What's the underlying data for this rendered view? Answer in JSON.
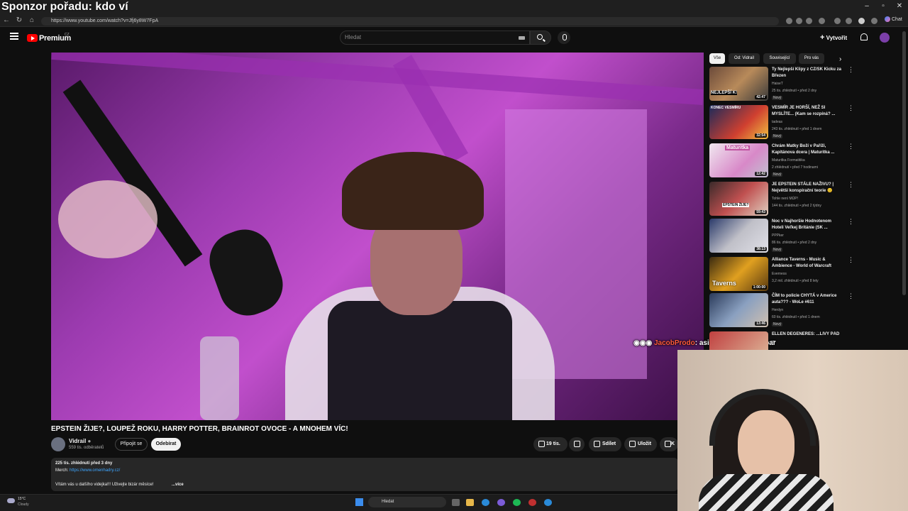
{
  "overlay_title": "Sponzor pořadu: kdo ví",
  "browser": {
    "url": "https://www.youtube.com/watch?v=Jfj6y8W7FpA",
    "copilot_label": "Chat",
    "window_buttons": [
      "–",
      "▫",
      "✕"
    ]
  },
  "header": {
    "logo_text": "Premium",
    "region": "CZ",
    "search_placeholder": "Hledat",
    "create_label": "Vytvořit"
  },
  "video": {
    "title": "EPSTEIN ŽIJE?, LOUPEŽ ROKU, HARRY POTTER, BRAINROT OVOCE - A MNOHEM VÍC!",
    "channel": "Vidrail",
    "subscribers": "559 tis. odběratelů",
    "join_label": "Připojit se",
    "subscribe_label": "Odebírat",
    "likes": "19 tis.",
    "share_label": "Sdílet",
    "save_label": "Uložit",
    "clip_label": "K"
  },
  "description": {
    "views_date": "225 tis. zhlédnutí  před 3 dny",
    "merch_label": "Merch:",
    "merch_link": "https://www.omenhadry.cz/",
    "text": "Vítám vás u dalšího videjka!!! Uživejte bizár měsíce!",
    "more_label": "...více"
  },
  "chat_overlay": {
    "user": "JacobProdo",
    "message": ": asi furt lepší než separ"
  },
  "sidebar": {
    "chips": [
      "Vše",
      "Od: Vidrail",
      "Související",
      "Pro vás"
    ],
    "items": [
      {
        "title": "Ty Nejlepší Klipy z CZ/SK Kicku za Březen",
        "channel": "HaiseT",
        "meta": "25 tis. zhlédnutí • před 2 dny",
        "badge": "Nový",
        "duration": "42:47",
        "thumb_text": "NEJLEPŠÍ K!"
      },
      {
        "title": "VESMÍR JE HORŠÍ, NEŽ SI MYSLÍTE... (Kam se rozpíná? ...",
        "channel": "tadeas",
        "meta": "243 tis. zhlédnutí • před 1 dnem",
        "badge": "Nový",
        "duration": "32:54",
        "thumb_text": "KONEC VESMÍRU"
      },
      {
        "title": "Chrám Matky Boží v Paříži, Kapitánova dcera | Maturitka ...",
        "channel": "Maturitka Formatitika",
        "meta": "2 zhlédnutí • před 7 hodinami",
        "badge": "Nový",
        "duration": "12:42",
        "thumb_text": "Maturitka"
      },
      {
        "title": "JE EPSTEIN STÁLE NAŽIVU? | Největší konspirační teorie 😐",
        "channel": "Tohle není MÚP!",
        "meta": "144 tis. zhlédnutí • před 2 týdny",
        "badge": "",
        "duration": "59:43",
        "thumb_text": "EPSTEIN ŽIJE?"
      },
      {
        "title": "Noc v Najhoršie Hodnotenom Hoteli Veľkej Británie (SK ...",
        "channel": "PPPker",
        "meta": "86 tis. zhlédnutí • před 2 dny",
        "badge": "Nový",
        "duration": "38:13",
        "thumb_text": ""
      },
      {
        "title": "Alliance Taverns - Music & Ambience - World of Warcraft",
        "channel": "Everness",
        "meta": "3,2 mil. zhlédnutí • před 8 lety",
        "badge": "",
        "duration": "1:00:00",
        "thumb_text": "Taverns"
      },
      {
        "title": "ČÍM to policie CHYTÁ v Americe auta??? - WoLe #611",
        "channel": "Herdyn",
        "meta": "60 tis. zhlédnutí • před 1 dnem",
        "badge": "Nový",
        "duration": "13:46",
        "thumb_text": ""
      },
      {
        "title": "ELLEN DEGENERES: ...LIVÝ PÁD ...",
        "channel": "",
        "meta": "",
        "badge": "",
        "duration": "",
        "thumb_text": ""
      }
    ]
  },
  "taskbar": {
    "temperature": "15°C",
    "weather": "Cloudy",
    "search_label": "Hledat"
  },
  "colors": {
    "accent_red": "#ff0000",
    "link_blue": "#3ea6ff",
    "chat_user": "#ff5a3c"
  }
}
